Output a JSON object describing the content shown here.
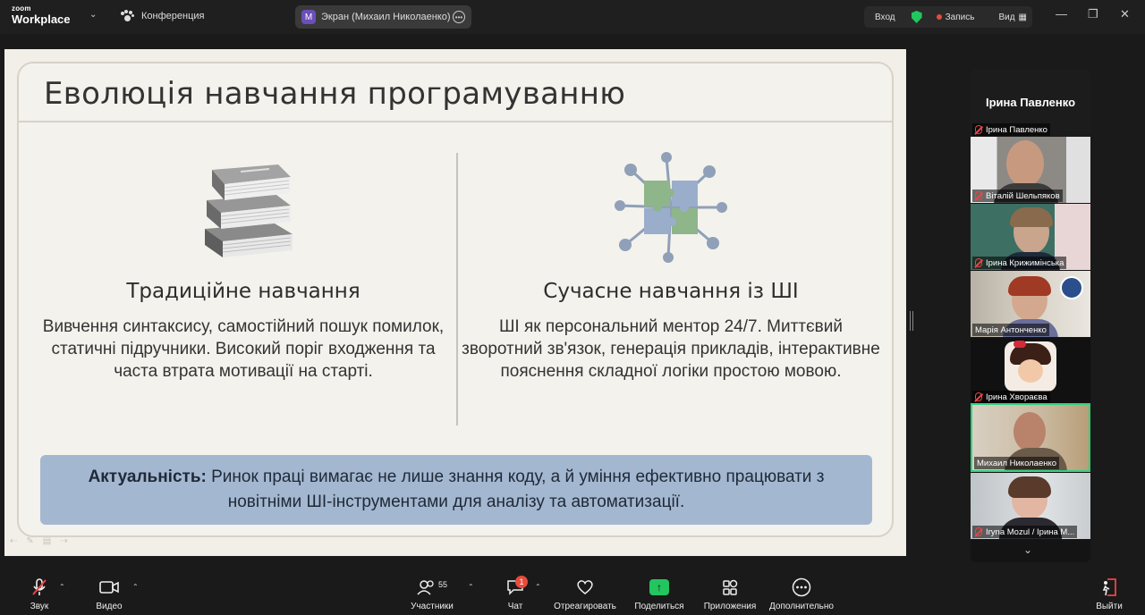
{
  "app": {
    "logo_top": "zoom",
    "logo_bottom": "Workplace",
    "meeting_name": "Конференция",
    "share_badge": "M",
    "share_label": "Экран (Михаил Николаенко)",
    "login": "Вход",
    "record": "Запись",
    "view": "Вид"
  },
  "slide": {
    "title": "Еволюція навчання програмуванню",
    "left_heading": "Традиційне навчання",
    "left_text": "Вивчення синтаксису, самостійний пошук помилок, статичні підручники. Високий поріг входження та часта втрата мотивації на старті.",
    "right_heading": "Сучасне навчання із ШІ",
    "right_text": "ШІ як персональний ментор 24/7. Миттєвий зворотний зв'язок, генерація прикладів, інтерактивне пояснення складної логіки простою мовою.",
    "note_bold": "Актуальність:",
    "note_text": " Ринок праці вимагає не лише знання коду, а й уміння ефективно працювати з новітніми ШІ-інструментами для аналізу та автоматизації."
  },
  "side_panel": {
    "header_name": "Ірина Павленко",
    "participants": [
      {
        "name": "Ірина Павленко",
        "muted": true
      },
      {
        "name": "Віталій Шельпяков",
        "muted": true
      },
      {
        "name": "Ірина Крижимінська",
        "muted": true
      },
      {
        "name": "Марія Антонченко",
        "muted": false
      },
      {
        "name": "Ірина Хвораєва",
        "muted": true
      },
      {
        "name": "Михаил Николаенко",
        "muted": false,
        "active": true
      },
      {
        "name": "Iryna Mozul / Ірина М...",
        "muted": true
      }
    ]
  },
  "toolbar": {
    "audio": "Звук",
    "video": "Видео",
    "participants": "Участники",
    "participants_count": "55",
    "chat": "Чат",
    "chat_badge": "1",
    "react": "Отреагировать",
    "share": "Поделиться",
    "apps": "Приложения",
    "more": "Дополнительно",
    "leave": "Выйти"
  },
  "colors": {
    "accent_green": "#22c55e",
    "active_tile": "#2dd37f",
    "record_red": "#e74c3c",
    "note_bg": "#a3b7d0"
  }
}
